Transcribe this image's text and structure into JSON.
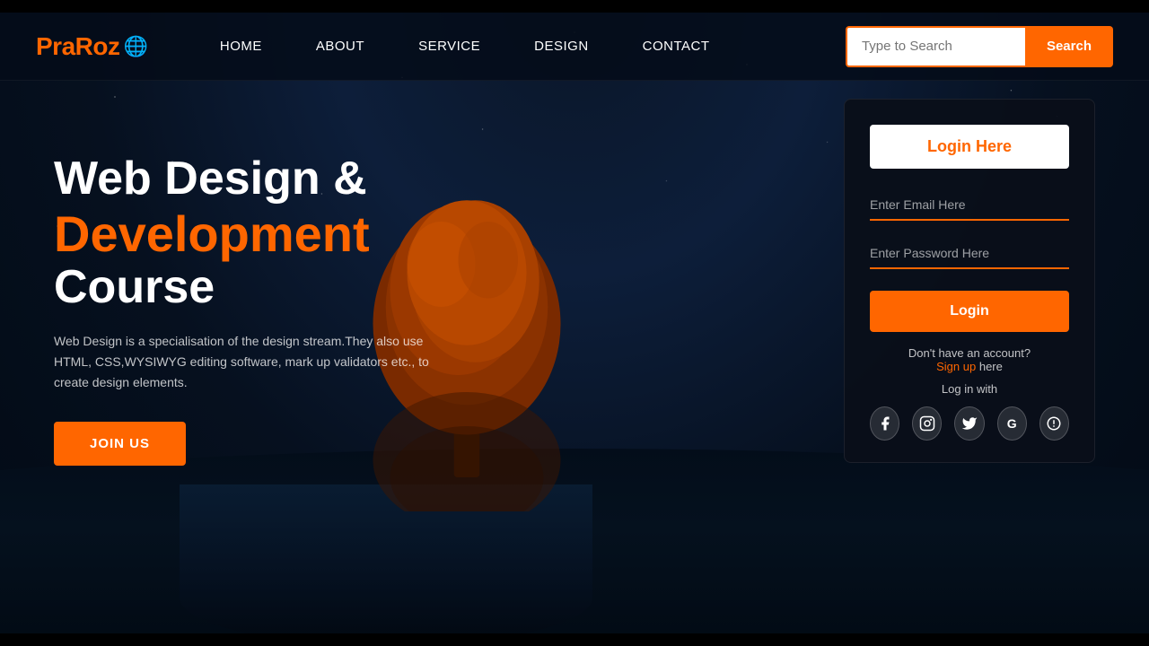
{
  "brand": {
    "name": "PraRoz",
    "globe": "🌐"
  },
  "navbar": {
    "links": [
      {
        "label": "HOME",
        "id": "home"
      },
      {
        "label": "ABOUT",
        "id": "about"
      },
      {
        "label": "SERVICE",
        "id": "service"
      },
      {
        "label": "DESIGN",
        "id": "design"
      },
      {
        "label": "CONTACT",
        "id": "contact"
      }
    ],
    "search": {
      "placeholder": "Type to Search",
      "button_label": "Search"
    }
  },
  "hero": {
    "title_line1": "Web Design &",
    "title_line2": "Development",
    "title_line3": "Course",
    "description": "Web Design is a specialisation of the design stream.They also use HTML, CSS,WYSIWYG editing software, mark up validators etc., to create design elements.",
    "join_button": "JOIN US"
  },
  "login_card": {
    "header_button": "Login Here",
    "email_placeholder": "Enter Email Here",
    "password_placeholder": "Enter Password Here",
    "login_button": "Login",
    "no_account_text": "Don't have an account?",
    "signup_link": "Sign up",
    "signup_suffix": " here",
    "login_with_text": "Log in with",
    "social_icons": [
      {
        "name": "facebook-icon",
        "symbol": "f"
      },
      {
        "name": "instagram-icon",
        "symbol": "📷"
      },
      {
        "name": "twitter-icon",
        "symbol": "𝕏"
      },
      {
        "name": "google-icon",
        "symbol": "G"
      },
      {
        "name": "skype-icon",
        "symbol": "S"
      }
    ]
  },
  "colors": {
    "accent": "#ff6600",
    "bg_dark": "#060e1c",
    "card_bg": "rgba(10,15,25,0.95)"
  }
}
